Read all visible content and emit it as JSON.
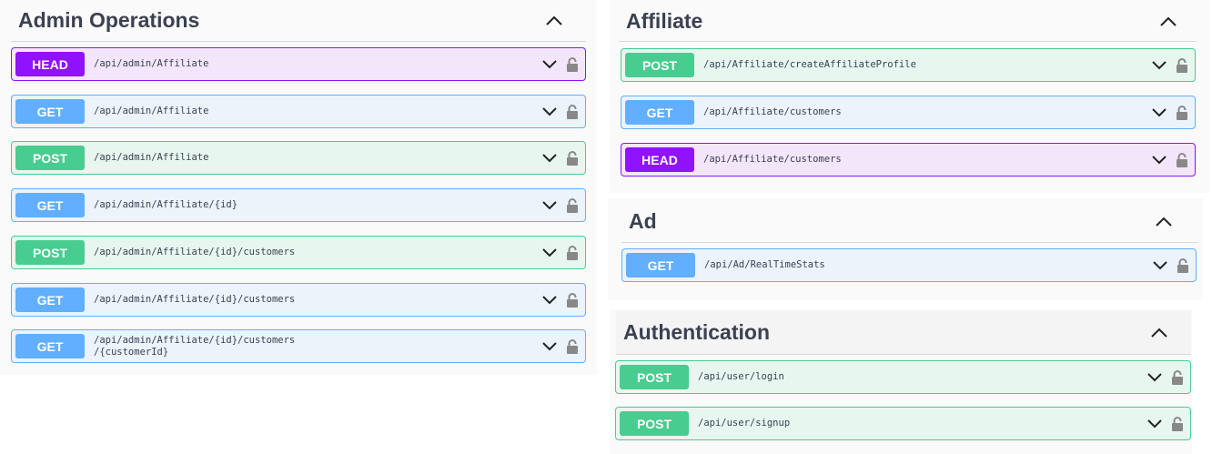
{
  "sections": {
    "admin": {
      "title": "Admin Operations",
      "ops": [
        {
          "method": "HEAD",
          "path": "/api/admin/Affiliate"
        },
        {
          "method": "GET",
          "path": "/api/admin/Affiliate"
        },
        {
          "method": "POST",
          "path": "/api/admin/Affiliate"
        },
        {
          "method": "GET",
          "path": "/api/admin/Affiliate/{id}"
        },
        {
          "method": "POST",
          "path": "/api/admin/Affiliate/{id}/customers"
        },
        {
          "method": "GET",
          "path": "/api/admin/Affiliate/{id}/customers"
        },
        {
          "method": "GET",
          "path": "/api/admin/Affiliate/{id}/customers\n/{customerId}"
        }
      ]
    },
    "affiliate": {
      "title": "Affiliate",
      "ops": [
        {
          "method": "POST",
          "path": "/api/Affiliate/createAffiliateProfile"
        },
        {
          "method": "GET",
          "path": "/api/Affiliate/customers"
        },
        {
          "method": "HEAD",
          "path": "/api/Affiliate/customers"
        }
      ]
    },
    "ad": {
      "title": "Ad",
      "ops": [
        {
          "method": "GET",
          "path": "/api/Ad/RealTimeStats"
        }
      ]
    },
    "auth": {
      "title": "Authentication",
      "ops": [
        {
          "method": "POST",
          "path": "/api/user/login"
        },
        {
          "method": "POST",
          "path": "/api/user/signup"
        }
      ]
    }
  },
  "colors": {
    "get": "#61affe",
    "post": "#49cc90",
    "head": "#9012fe",
    "text": "#3b4151"
  },
  "icons": {
    "collapse": "chevron-up-icon",
    "expand": "chevron-down-icon",
    "lock": "lock-icon"
  }
}
